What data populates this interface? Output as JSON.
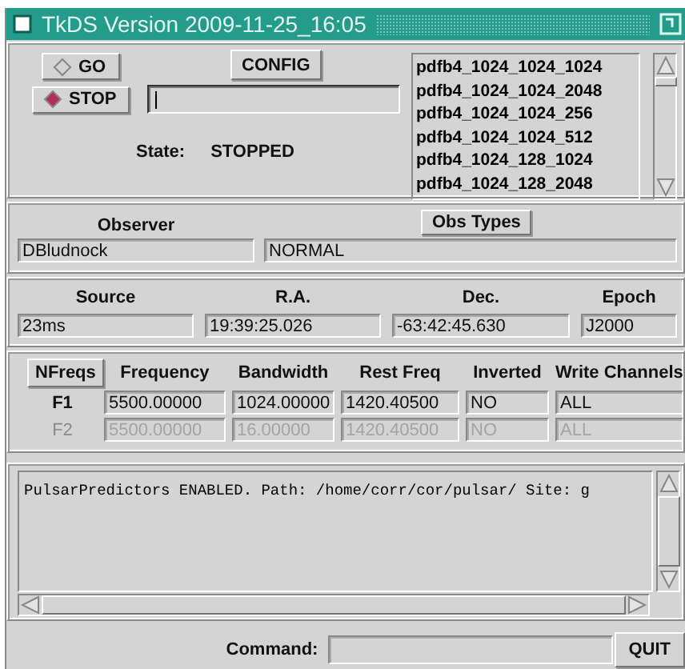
{
  "window": {
    "title": "TkDS  Version 2009-11-25_16:05"
  },
  "controls": {
    "run_buttons": [
      {
        "label": "GO",
        "selected": false
      },
      {
        "label": "STOP",
        "selected": true
      }
    ],
    "config_button": "CONFIG",
    "state_label": "State:",
    "state_value": "STOPPED"
  },
  "config_list": {
    "items": [
      "pdfb4_1024_1024_1024",
      "pdfb4_1024_1024_2048",
      "pdfb4_1024_1024_256",
      "pdfb4_1024_1024_512",
      "pdfb4_1024_128_1024",
      "pdfb4_1024_128_2048"
    ]
  },
  "observer": {
    "label": "Observer",
    "value": "DBludnock",
    "obs_types_button": "Obs Types",
    "obs_type": "NORMAL"
  },
  "source": {
    "fields": [
      {
        "label": "Source",
        "value": "23ms"
      },
      {
        "label": "R.A.",
        "value": "19:39:25.026"
      },
      {
        "label": "Dec.",
        "value": "-63:42:45.630"
      },
      {
        "label": "Epoch",
        "value": "J2000"
      }
    ]
  },
  "frequencies": {
    "nfreqs_button": "NFreqs",
    "columns": [
      "Frequency",
      "Bandwidth",
      "Rest Freq",
      "Inverted",
      "Write Channels"
    ],
    "rows": [
      {
        "label": "F1",
        "disabled": false,
        "values": [
          "5500.00000",
          "1024.00000",
          "1420.40500",
          "NO",
          "ALL"
        ]
      },
      {
        "label": "F2",
        "disabled": true,
        "values": [
          "5500.00000",
          "16.00000",
          "1420.40500",
          "NO",
          "ALL"
        ]
      }
    ]
  },
  "log": {
    "lines": [
      "PulsarPredictors ENABLED. Path: /home/corr/cor/pulsar/ Site: g"
    ]
  },
  "command": {
    "label": "Command:",
    "quit_button": "QUIT"
  }
}
